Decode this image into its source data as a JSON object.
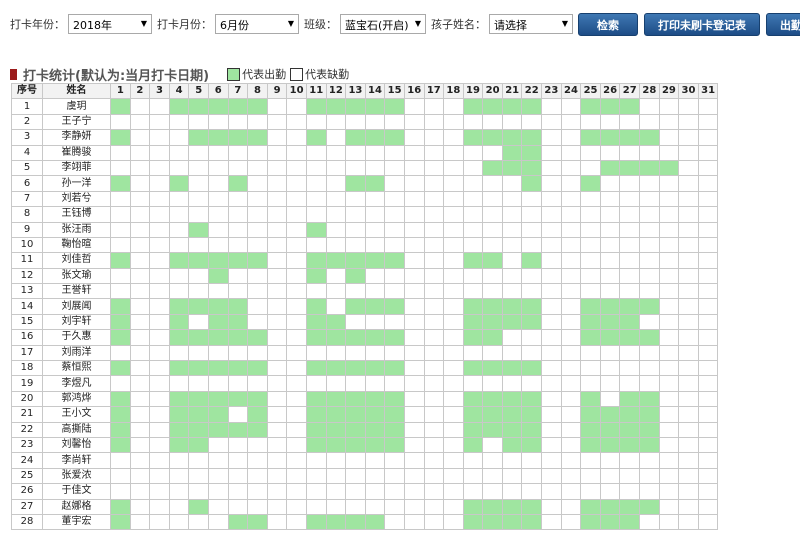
{
  "filters": {
    "year_label": "打卡年份：",
    "year_value": "2018年",
    "month_label": "打卡月份：",
    "month_value": "6月份",
    "class_label": "班级：",
    "class_value": "蓝宝石(开启)",
    "child_label": "孩子姓名：",
    "child_value": "请选择",
    "search_button": "检索",
    "print_button": "打印未刷卡登记表",
    "attendance_button": "出勤登"
  },
  "section": {
    "title": "打卡统计(默认为:当月打卡日期)",
    "legend_present": "代表出勤",
    "legend_absent": "代表缺勤",
    "present_color": "#9fe5a0",
    "absent_color": "#ffffff"
  },
  "table": {
    "col_index": "序号",
    "col_name": "姓名",
    "days": [
      "1",
      "2",
      "3",
      "4",
      "5",
      "6",
      "7",
      "8",
      "9",
      "10",
      "11",
      "12",
      "13",
      "14",
      "15",
      "16",
      "17",
      "18",
      "19",
      "20",
      "21",
      "22",
      "23",
      "24",
      "25",
      "26",
      "27",
      "28",
      "29",
      "30",
      "31"
    ],
    "rows": [
      {
        "no": "1",
        "name": "虞玥",
        "present": [
          1,
          4,
          5,
          6,
          7,
          8,
          11,
          12,
          13,
          14,
          15,
          19,
          20,
          21,
          22,
          25,
          26,
          27
        ]
      },
      {
        "no": "2",
        "name": "王子宁",
        "present": []
      },
      {
        "no": "3",
        "name": "李静妍",
        "present": [
          1,
          5,
          6,
          7,
          8,
          11,
          13,
          14,
          15,
          19,
          20,
          21,
          22,
          25,
          26,
          27,
          28
        ]
      },
      {
        "no": "4",
        "name": "崔腾骏",
        "present": [
          21,
          22
        ]
      },
      {
        "no": "5",
        "name": "李翊菲",
        "present": [
          20,
          21,
          22,
          26,
          27,
          28,
          29
        ]
      },
      {
        "no": "6",
        "name": "孙一洋",
        "present": [
          1,
          4,
          7,
          13,
          14,
          22,
          25
        ]
      },
      {
        "no": "7",
        "name": "刘若兮",
        "present": []
      },
      {
        "no": "8",
        "name": "王钰博",
        "present": []
      },
      {
        "no": "9",
        "name": "张汪雨",
        "present": [
          5,
          11
        ]
      },
      {
        "no": "10",
        "name": "鞠怡暄",
        "present": []
      },
      {
        "no": "11",
        "name": "刘佳哲",
        "present": [
          1,
          4,
          5,
          6,
          7,
          8,
          11,
          12,
          13,
          14,
          15,
          19,
          20,
          22
        ]
      },
      {
        "no": "12",
        "name": "张文瑜",
        "present": [
          6,
          11,
          13
        ]
      },
      {
        "no": "13",
        "name": "王誉轩",
        "present": []
      },
      {
        "no": "14",
        "name": "刘展闻",
        "present": [
          1,
          4,
          5,
          6,
          7,
          11,
          13,
          14,
          15,
          19,
          20,
          21,
          22,
          25,
          26,
          27,
          28
        ]
      },
      {
        "no": "15",
        "name": "刘宇轩",
        "present": [
          1,
          4,
          6,
          7,
          11,
          12,
          19,
          20,
          21,
          22,
          25,
          26,
          27
        ]
      },
      {
        "no": "16",
        "name": "于久惠",
        "present": [
          1,
          4,
          5,
          6,
          7,
          8,
          11,
          12,
          13,
          14,
          15,
          19,
          20,
          25,
          26,
          27,
          28
        ]
      },
      {
        "no": "17",
        "name": "刘雨洋",
        "present": []
      },
      {
        "no": "18",
        "name": "蔡恒熙",
        "present": [
          1,
          4,
          5,
          6,
          7,
          8,
          11,
          12,
          13,
          14,
          15,
          19,
          20,
          21,
          22
        ]
      },
      {
        "no": "19",
        "name": "李煜凡",
        "present": []
      },
      {
        "no": "20",
        "name": "郭鸿烨",
        "present": [
          1,
          4,
          5,
          6,
          7,
          8,
          11,
          12,
          13,
          14,
          15,
          19,
          20,
          21,
          22,
          25,
          27,
          28
        ]
      },
      {
        "no": "21",
        "name": "王小文",
        "present": [
          1,
          4,
          5,
          6,
          8,
          11,
          12,
          13,
          14,
          15,
          19,
          20,
          21,
          22,
          25,
          26,
          27,
          28
        ]
      },
      {
        "no": "22",
        "name": "高撕陆",
        "present": [
          1,
          4,
          5,
          6,
          7,
          8,
          11,
          12,
          13,
          14,
          15,
          19,
          20,
          21,
          22,
          25,
          26,
          27,
          28
        ]
      },
      {
        "no": "23",
        "name": "刘馨怡",
        "present": [
          1,
          4,
          5,
          11,
          12,
          13,
          14,
          15,
          19,
          21,
          22,
          25,
          26,
          27,
          28
        ]
      },
      {
        "no": "24",
        "name": "李尚轩",
        "present": []
      },
      {
        "no": "25",
        "name": "张爱浓",
        "present": []
      },
      {
        "no": "26",
        "name": "于佳文",
        "present": []
      },
      {
        "no": "27",
        "name": "赵娜格",
        "present": [
          1,
          5,
          19,
          20,
          21,
          22,
          25,
          26,
          27,
          28
        ]
      },
      {
        "no": "28",
        "name": "董宇宏",
        "present": [
          1,
          7,
          8,
          11,
          12,
          13,
          14,
          19,
          20,
          21,
          22,
          25,
          26,
          27
        ]
      }
    ]
  }
}
